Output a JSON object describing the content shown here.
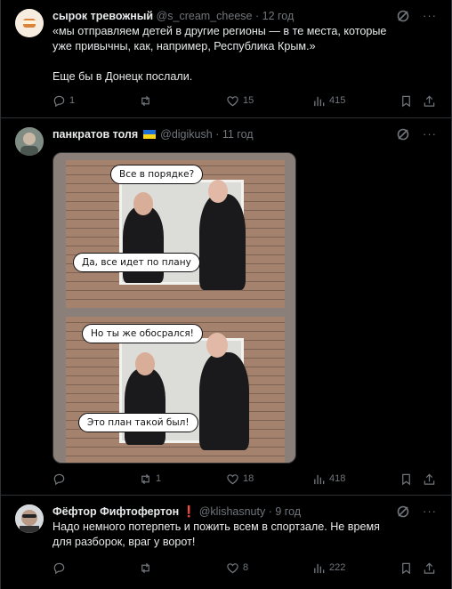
{
  "posts": [
    {
      "author": "сырок тревожный",
      "handle": "@s_cream_cheese",
      "sep": "·",
      "time": "12 год",
      "text": "«мы отправляем детей в другие регионы — в те места, которые уже привычны, как, например, Республика Крым.»\n\nЕще бы в Донецк послали.",
      "replies": "1",
      "reposts": "",
      "likes": "15",
      "views": "415"
    },
    {
      "author": "панкратов толя",
      "handle": "@digikush",
      "sep": "·",
      "time": "11 год",
      "media": {
        "bubble1": "Все в порядке?",
        "bubble2": "Да, все идет по плану",
        "bubble3": "Но ты же обосрался!",
        "bubble4": "Это план такой был!"
      },
      "replies": "",
      "reposts": "1",
      "likes": "18",
      "views": "418"
    },
    {
      "author": "Фёфтор Фифтофертон",
      "badge": "❗",
      "handle": "@klishasnuty",
      "sep": "·",
      "time": "9 год",
      "text": "Надо немного потерпеть и пожить всем в спортзале. Не время для разборок, враг у ворот!",
      "replies": "",
      "reposts": "",
      "likes": "8",
      "views": "222"
    }
  ],
  "colors": {
    "bg": "#000000",
    "text": "#e7e9ea",
    "muted": "#71767b",
    "border": "#2f3336"
  },
  "icons": [
    "grok-icon",
    "more-icon",
    "reply-icon",
    "repost-icon",
    "like-icon",
    "views-icon",
    "bookmark-icon",
    "share-icon"
  ]
}
